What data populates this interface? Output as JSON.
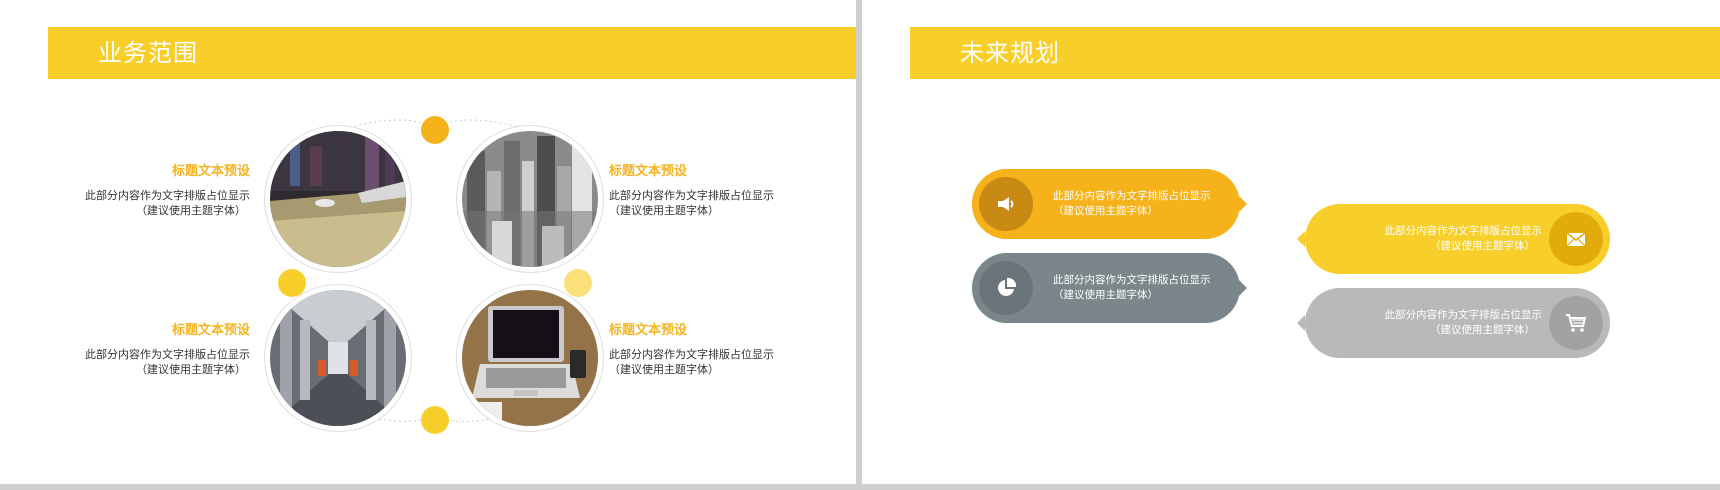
{
  "left_slide": {
    "title": "业务范围",
    "items": [
      {
        "title": "标题文本预设",
        "line1": "此部分内容作为文字排版占位显示",
        "line2": "（建议使用主题字体）"
      },
      {
        "title": "标题文本预设",
        "line1": "此部分内容作为文字排版占位显示",
        "line2": "（建议使用主题字体）"
      },
      {
        "title": "标题文本预设",
        "line1": "此部分内容作为文字排版占位显示",
        "line2": "（建议使用主题字体）"
      },
      {
        "title": "标题文本预设",
        "line1": "此部分内容作为文字排版占位显示",
        "line2": "（建议使用主题字体）"
      }
    ],
    "photos": [
      "desk-mouse-photo",
      "city-skyline-photo",
      "atrium-elevators-photo",
      "laptop-desk-photo"
    ]
  },
  "right_slide": {
    "title": "未来规划",
    "pills": [
      {
        "line1": "此部分内容作为文字排版占位显示",
        "line2": "（建议使用主题字体）",
        "icon": "megaphone-icon",
        "color": "#f5b21b"
      },
      {
        "line1": "此部分内容作为文字排版占位显示",
        "line2": "（建议使用主题字体）",
        "icon": "pie-chart-icon",
        "color": "#7b868a"
      },
      {
        "line1": "此部分内容作为文字排版占位显示",
        "line2": "（建议使用主题字体）",
        "icon": "envelope-icon",
        "color": "#f8cf2a"
      },
      {
        "line1": "此部分内容作为文字排版占位显示",
        "line2": "（建议使用主题字体）",
        "icon": "shopping-cart-icon",
        "color": "#b9b9b9"
      }
    ]
  },
  "colors": {
    "accent": "#f8cf2a",
    "accent_dark": "#f5b21b",
    "gray": "#7b868a",
    "light_gray": "#b9b9b9",
    "title_orange": "#f5b521"
  }
}
